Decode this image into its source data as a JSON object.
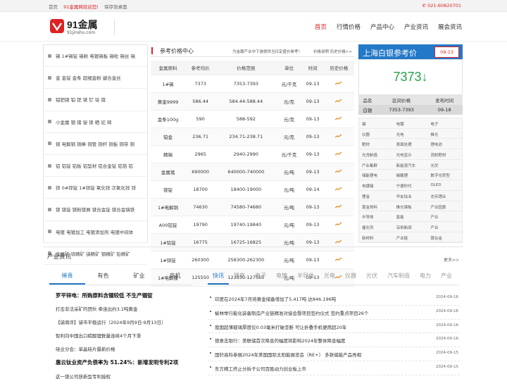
{
  "topbar": {
    "home": "首页",
    "welcome": "91金属网欢迎您!",
    "save_desktop": "保存到桌面",
    "phone": "021-60820701"
  },
  "logo": {
    "name": "91金属",
    "domain": "91jinshu.com"
  },
  "nav": [
    "首页",
    "行情价格",
    "产品中心",
    "产业资讯",
    "展会资讯"
  ],
  "categories": [
    "锡 1#锡锭 锡粉 电镀锡板 锡粒 锡丝 锡",
    "金 金锭 金条 超细金粉 键合金丝",
    "铂钯铑 铂 钯 铑 钌 铱 锇",
    "小金属 铟 锗 铋 镓 硒 铊 碲",
    "铜 电解铜 铜棒 铜管 铜杆 铜板 铜带 铜",
    "铝 铝锭 铝板 铝型材 铝合金锭 铝箔 铝",
    "锌 0#锌锭 1#锌锭 氧化锌 次氧化锌 锌",
    "镁 镁锭 镁粉镁屑 镁合金锭 镁合金镜铁",
    "电镀 电镀加工 电镀添加剂 电镀中间体",
    "金属矿 锌精矿 锑精矿 铜精矿 铅精矿"
  ],
  "price_center": {
    "title": "参考价格中心",
    "notice": "为金属产业中下游提供当日定盘价参考！",
    "help": "价格说明",
    "history": "历史价格>>",
    "columns": [
      "金属原料",
      "参考均价",
      "价格范围",
      "单位",
      "时间",
      "历史价格"
    ],
    "rows": [
      [
        "1#锡",
        "7373",
        "7353-7393",
        "元/千克",
        "09-13"
      ],
      [
        "黄金9999",
        "586.44",
        "584.44-588.44",
        "元/克",
        "09-13"
      ],
      [
        "金条100g",
        "590",
        "588-592",
        "元/克",
        "09-13"
      ],
      [
        "铂金",
        "236.71",
        "234.71-238.71",
        "元/克",
        "09-13"
      ],
      [
        "精锡",
        "2965",
        "2940-2990",
        "元/千克",
        "09-13"
      ],
      [
        "金属锗",
        "690000",
        "640000-740000",
        "元/吨",
        "09-13"
      ],
      [
        "镁锭",
        "18700",
        "18400-19000",
        "元/吨",
        "09-14"
      ],
      [
        "1#电解铜",
        "74630",
        "74580-74680",
        "元/吨",
        "09-13"
      ],
      [
        "A00铝锭",
        "19790",
        "19740-19840",
        "元/吨",
        "09-13"
      ],
      [
        "1#铅锭",
        "16775",
        "16725-16825",
        "元/吨",
        "09-13"
      ],
      [
        "1#锌锭",
        "260300",
        "258300-262300",
        "元/吨",
        "09-13"
      ],
      [
        "1#电解镍",
        "125550",
        "123550-127550",
        "元/吨",
        "09-13"
      ]
    ]
  },
  "silver": {
    "title": "上海白银参考价",
    "date": "09-13",
    "price": "7373↓",
    "table_head": [
      "品名",
      "区间价格",
      "发布时间"
    ],
    "table_row": [
      "白银",
      "7353-7393",
      "09-18"
    ],
    "tags": [
      "锡",
      "电镀",
      "电子",
      "仪器",
      "光电",
      "推光",
      "靶材",
      "表面处理",
      "锂电池",
      "光洗制造",
      "光电显示",
      "消射靶材",
      "产业集群",
      "新能源汽车",
      "光伏",
      "储能锂电",
      "碳酸锂",
      "数字化转型",
      "电镀锡",
      "宁德时代",
      "OLED",
      "锂金",
      "华友钴业",
      "志存锂业",
      "黄金饰料",
      "推光钢板",
      "产业园景",
      "半导体",
      "氢能",
      "产业",
      "催化剂",
      "深圳新闻",
      "产业",
      "新材料",
      "产业链",
      "镁合金"
    ]
  },
  "news": {
    "title": "产业资讯",
    "more": "更多>>",
    "left_tabs": [
      "稀贵",
      "有色",
      "矿业",
      "商机"
    ],
    "left_items": [
      {
        "text": "罗平锌电：所购原料含锢较低 不生产锢锭",
        "bold": true
      },
      {
        "text": "打击非法采矿的团伙 牵连出约3.1吨黄金",
        "bold": false
      },
      {
        "text": "【锑周评】锑市平稳运行（2024年9月9日-9月13日）",
        "bold": false
      },
      {
        "text": "智利向中国出口碳酸锂数量连续4个月下滑",
        "bold": false
      },
      {
        "text": "硅业分会：单晶硅片最新价格",
        "bold": false
      },
      {
        "text": "惠云钛业资产负债率为 51.24%：新增发明专利2项",
        "bold": true
      },
      {
        "text": "这一镁公司获新型专利授权",
        "bold": false
      }
    ],
    "right_tabs": [
      "快讯",
      "锂电",
      "电子",
      "电镀",
      "半导体",
      "光电",
      "仪器",
      "光伏",
      "汽车制造",
      "电力",
      "产业"
    ],
    "right_items": [
      {
        "text": "印度在2024年7月将黄金储备增加了5.417吨 达846.196吨",
        "date": "2024-09-16"
      },
      {
        "text": "榆林举行能化装备制造产业链精准对接会暨项目签约仪式 签约重点项目26个",
        "date": "2024-09-16"
      },
      {
        "text": "我国超薄玻璃厚度仅0.03毫米打破垄断 可让折叠手机便用超20年",
        "date": "2024-09-16"
      },
      {
        "text": "德意志银行：美联储首次降息的幅度将影响2024年整体降息幅度",
        "date": "2024-09-16"
      },
      {
        "text": "国轩高科参展2024年美国国际太阳能展览会（RE+） 多款储能产品亮相",
        "date": "2024-09-15"
      },
      {
        "text": "东方精工终止分拆子公司百胜动力创业板上市",
        "date": "2024-09-15"
      }
    ]
  },
  "colors": {
    "accent_red": "#dd2222",
    "accent_blue": "#2378c7",
    "down_green": "#21a04a"
  }
}
